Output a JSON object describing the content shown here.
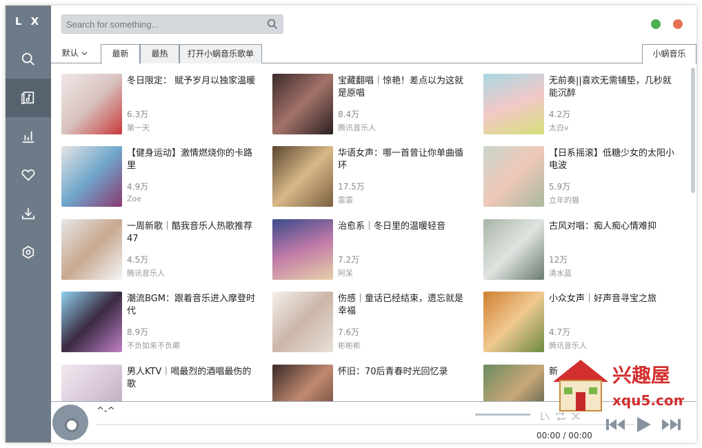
{
  "sidebar": {
    "logo": "L X",
    "items": [
      {
        "name": "search"
      },
      {
        "name": "songlist"
      },
      {
        "name": "leaderboard"
      },
      {
        "name": "favorites"
      },
      {
        "name": "download"
      },
      {
        "name": "settings"
      }
    ]
  },
  "search": {
    "placeholder": "Search for something..."
  },
  "window": {
    "min_color": "#4caf50",
    "close_color": "#e57254"
  },
  "tabs": {
    "sort": "默认",
    "newest": "最新",
    "hottest": "最热",
    "open_list": "打开小蜗音乐歌单",
    "source": "小蜗音乐"
  },
  "cards": [
    {
      "title": "冬日限定： 赋予岁月以独家温暖",
      "count": "6.3万",
      "author": "第一天"
    },
    {
      "title": "宝藏翻唱｜惊艳！差点以为这就是原唱",
      "count": "8.4万",
      "author": "腾讯音乐人"
    },
    {
      "title": "无前奏||喜欢无需铺垫，几秒就能沉醉",
      "count": "4.2万",
      "author": "太白v"
    },
    {
      "title": "【健身运动】激情燃烧你的卡路里",
      "count": "4.9万",
      "author": "Zoe"
    },
    {
      "title": "华语女声：哪一首曾让你单曲循环",
      "count": "17.5万",
      "author": "霏霏"
    },
    {
      "title": "【日系摇滚】低糖少女的太阳小电波",
      "count": "5.9万",
      "author": "立年的猫"
    },
    {
      "title": "一周新歌｜酷我音乐人热歌推荐47",
      "count": "4.5万",
      "author": "腾讯音乐人"
    },
    {
      "title": "治愈系｜冬日里的温暖轻音",
      "count": "7.2万",
      "author": "阿呆"
    },
    {
      "title": "古风对唱：痴人痴心情难抑",
      "count": "12万",
      "author": "清水蓝"
    },
    {
      "title": "潮流BGM：跟着音乐进入摩登时代",
      "count": "8.9万",
      "author": "不负如来不负卿"
    },
    {
      "title": "伤感｜童话已经结束，遗忘就是幸福",
      "count": "7.6万",
      "author": "彬彬彬"
    },
    {
      "title": "小众女声｜好声音寻宝之旅",
      "count": "4.7万",
      "author": "腾讯音乐人"
    },
    {
      "title": "男人KTV｜喝最烈的酒唱最伤的歌",
      "count": "",
      "author": ""
    },
    {
      "title": "怀旧：70后青春时光回忆录",
      "count": "",
      "author": ""
    },
    {
      "title": "新",
      "count": "",
      "author": ""
    }
  ],
  "player": {
    "song": "^-^",
    "current_time": "00:00",
    "separator": "/",
    "total_time": "00:00"
  },
  "watermark": {
    "brand": "兴趣屋",
    "site": "xqu5.com"
  }
}
